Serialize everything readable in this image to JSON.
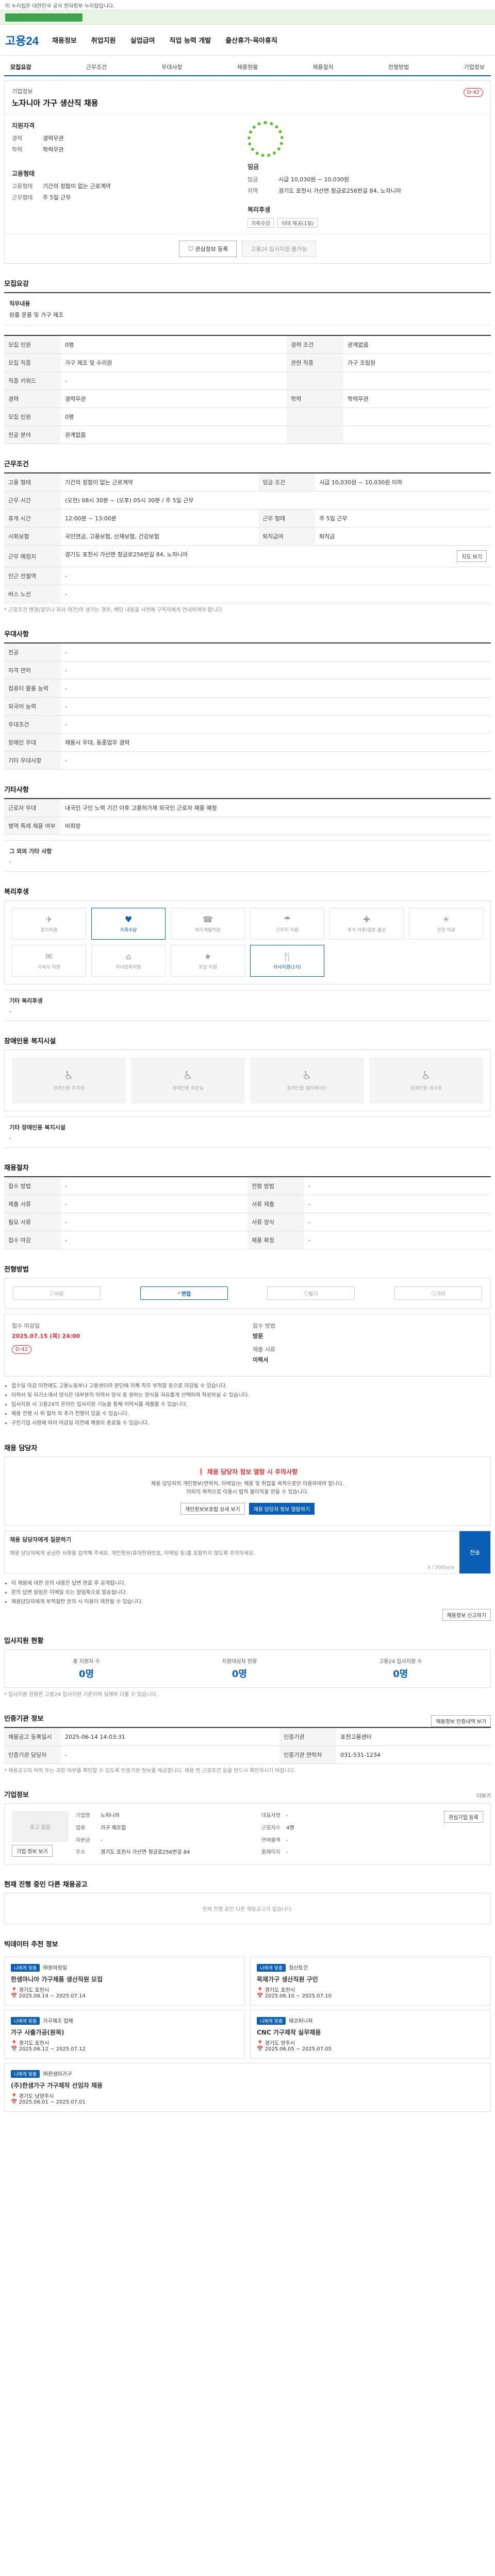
{
  "topbar": {
    "text": "이 누리집은 대한민국 공식 전자정부 누리집입니다."
  },
  "header": {
    "logo": "고용24",
    "nav": [
      "채용정보",
      "취업지원",
      "실업급여",
      "직업 능력 개발",
      "출산휴가·육아휴직"
    ]
  },
  "subnav": [
    "모집요강",
    "근무조건",
    "우대사항",
    "채용현황",
    "채용절차",
    "전형방법",
    "기업정보"
  ],
  "job": {
    "company": "기업정보",
    "title": "노자니아 가구 생산직 채용",
    "dday": "D-42",
    "summary_left": [
      {
        "k": "경력",
        "v": "경력무관"
      },
      {
        "k": "학력",
        "v": "학력무관"
      }
    ],
    "summary_left_title": "지원자격",
    "summary_left2_title": "고용형태",
    "summary_left2": [
      {
        "k": "고용형태",
        "v": "기간의 정함이 없는 근로계약"
      },
      {
        "k": "근무형태",
        "v": "주 5일 근무"
      }
    ],
    "summary_right_title": "임금",
    "summary_right": [
      {
        "k": "임금",
        "v": "시급 10,030원 ~ 10,030원"
      },
      {
        "k": "지역",
        "v": "경기도 포천시 가산면 청금로256번길 84, 노자니아"
      }
    ],
    "summary_right2_title": "복리후생",
    "tags": [
      "가족수당",
      "식대 제공(1일)"
    ],
    "btn_scrap": "관심정보 등록",
    "btn_apply": "고용24 입사지원 불가능"
  },
  "recruit": {
    "title": "모집요강",
    "duty_title": "직무내용",
    "duty": "원룸 운용 및 가구 제조",
    "rows": [
      [
        {
          "k": "모집 인원",
          "v": "0명"
        },
        {
          "k": "경력 조건",
          "v": "관계없음"
        }
      ],
      [
        {
          "k": "모집 직종",
          "v": "가구 제조 및 수리원"
        },
        {
          "k": "관련 직종",
          "v": "가구 조립원"
        }
      ],
      [
        {
          "k": "직종 키워드",
          "v": "-"
        },
        {
          "k": "",
          "v": ""
        }
      ],
      [
        {
          "k": "경력",
          "v": "경력무관"
        },
        {
          "k": "학력",
          "v": "학력무관"
        }
      ],
      [
        {
          "k": "모집 인원",
          "v": "0명"
        },
        {
          "k": "",
          "v": ""
        }
      ],
      [
        {
          "k": "전공 분야",
          "v": "관계없음"
        },
        {
          "k": "",
          "v": ""
        }
      ]
    ]
  },
  "work": {
    "title": "근무조건",
    "rows": [
      {
        "k": "고용 형태",
        "v": "기간의 정함이 없는 근로계약",
        "k2": "임금 조건",
        "v2": "시급 10,030원 ~ 10,030원 이하"
      },
      {
        "k": "근무 시간",
        "v": "(오전) 08시 30분 ~ (오후) 05시 30분 / 주 5일 근무",
        "k2": "",
        "v2": ""
      },
      {
        "k": "휴게 시간",
        "v": "12:00분 ~ 13:00분",
        "k2": "근무 형태",
        "v2": "주 5일 근무"
      },
      {
        "k": "사회보험",
        "v": "국민연금, 고용보험, 산재보험, 건강보험",
        "k2": "퇴직급여",
        "v2": "퇴직금"
      },
      {
        "k": "근무 예정지",
        "v": "경기도 포천시 가산면 청금로256번길 84, 노자니아",
        "k2": "",
        "v2": ""
      },
      {
        "k": "인근 전철역",
        "v": "-",
        "k2": "",
        "v2": ""
      },
      {
        "k": "버스 노선",
        "v": "-",
        "k2": "",
        "v2": ""
      }
    ],
    "map_btn": "지도 보기",
    "note": "* 근로조건 변경(업무나 회사 여건)이 생기는 경우, 해당 내용을 사전에 구직자에게 안내하여야 합니다."
  },
  "prefer": {
    "title": "우대사항",
    "rows": [
      {
        "k": "전공",
        "v": "-"
      },
      {
        "k": "자격 면허",
        "v": "-"
      },
      {
        "k": "컴퓨터 활용 능력",
        "v": "-"
      },
      {
        "k": "외국어 능력",
        "v": "-"
      },
      {
        "k": "우대조건",
        "v": "-"
      },
      {
        "k": "장애인 우대",
        "v": "채용시 우대, 동종업무 경력"
      },
      {
        "k": "기타 우대사항",
        "v": "-"
      }
    ]
  },
  "other": {
    "title": "기타사항",
    "rows": [
      {
        "k": "근로자 우대",
        "v": "내국인 구인 노력 기간 이후 고용허가제 외국인 근로자 채용 예정"
      },
      {
        "k": "병역 특례 채용 여부",
        "v": "비희망"
      }
    ],
    "extra_title": "그 외의 기타 사항",
    "extra": "-"
  },
  "welfare": {
    "title": "복리후생",
    "items": [
      {
        "icon": "✈",
        "label": "휴가지원",
        "on": false
      },
      {
        "icon": "♥",
        "label": "가족수당",
        "on": true
      },
      {
        "icon": "☎",
        "label": "자기계발지원",
        "on": false
      },
      {
        "icon": "☂",
        "label": "근무지 지원",
        "on": false
      },
      {
        "icon": "✚",
        "label": "주거 지원/결혼·출산",
        "on": false
      },
      {
        "icon": "☀",
        "label": "건강·의료",
        "on": false
      },
      {
        "icon": "✉",
        "label": "기숙사 지원",
        "on": false
      },
      {
        "icon": "⌂",
        "label": "자녀양육지원",
        "on": false
      },
      {
        "icon": "★",
        "label": "포상 지원",
        "on": false
      },
      {
        "icon": "🍴",
        "label": "식사지원(1식)",
        "on": true
      }
    ],
    "extra_title": "기타 복리후생",
    "extra": "-"
  },
  "disability": {
    "title": "장애인용 복지시설",
    "items": [
      {
        "icon": "♿",
        "label": "장애인용 주차장"
      },
      {
        "icon": "♿",
        "label": "장애인용 화장실"
      },
      {
        "icon": "♿",
        "label": "장애인용 엘리베이터"
      },
      {
        "icon": "♿",
        "label": "장애인용 경사로"
      }
    ],
    "extra_title": "기타 장애인용 복지시설",
    "extra": "-"
  },
  "process": {
    "title": "채용절차",
    "rows": [
      {
        "k": "접수 방법",
        "v": "-",
        "k2": "전형 방법",
        "v2": "-"
      },
      {
        "k": "제출 서류",
        "v": "-",
        "k2": "서류 제출",
        "v2": "-"
      },
      {
        "k": "필요 서류",
        "v": "-",
        "k2": "서류 양식",
        "v2": "-"
      },
      {
        "k": "접수 마감",
        "v": "-",
        "k2": "채용 확정",
        "v2": "-"
      }
    ]
  },
  "method": {
    "title": "전형방법",
    "steps": [
      {
        "label": "서류",
        "on": false
      },
      {
        "label": "면접",
        "on": true
      },
      {
        "label": "필기",
        "on": false
      },
      {
        "label": "기타",
        "on": false
      }
    ],
    "apply_deadline_label": "접수 마감일",
    "apply_deadline": "2025.07.15 (목) 24:00",
    "dday": "D-42",
    "method_label": "접수 방법",
    "method_value": "방문",
    "docs_label": "제출 서류",
    "docs_value": "이력서",
    "notes": [
      "접수일 마감 이전에도 고용노동부나 고용센터의 판단에 의해 직무 부적합 등으로 마감될 수 있습니다.",
      "이력서 및 자기소개서 양식은 대부분의 이력서 양식 중 원하는 양식을 자유롭게 선택하여 작성하실 수 있습니다.",
      "입사지원 시 고용24의 온라인 입사지원 기능을 통해 이력서를 제출할 수 있습니다.",
      "채용 진행 시 위 절차 외 추가 전형이 있을 수 있습니다.",
      "구인기업 사정에 따라 마감일 이전에 채용이 종료될 수 있습니다."
    ]
  },
  "manager": {
    "title": "채용 담당자",
    "warn_prefix": "채용 담당자 정보 열람 시 주의사항",
    "desc1": "채용 담당자의 개인정보(연락처, 이메일)는 채용 및 취업을 목적으로만 이용하여야 합니다.",
    "desc2": "이외의 목적으로 이용시 법적 불이익을 받을 수 있습니다.",
    "btn_company": "개인정보보호법 상세 보기",
    "btn_view": "채용 담당자 정보 열람하기",
    "inq_title": "채용 담당자에게 질문하기",
    "inq_placeholder": "채용 담당자에게 궁금한 사항을 입력해 주세요. 개인정보(휴대전화번호, 이메일 등)를 포함하지 않도록 주의하세요.",
    "inq_btn": "전송",
    "inq_count": "0 / 500byte",
    "notes": [
      "이 채용에 대한 문의 내용은 답변 완료 후 공개됩니다.",
      "문의 답변 알림은 이메일 또는 알림톡으로 발송됩니다.",
      "채용담당자에게 부적절한 문의 시 이용이 제한될 수 있습니다."
    ],
    "report_btn": "채용정보 신고하기"
  },
  "status": {
    "title": "입사지원 현황",
    "items": [
      {
        "l": "총 지원자 수",
        "n": "0명"
      },
      {
        "l": "지원대상자 현황",
        "n": "0명"
      },
      {
        "l": "고용24 입사지원 수",
        "n": "0명"
      }
    ],
    "note": "* 입사지원 현황은 고용24 입사지원 기준이며 실제와 다를 수 있습니다."
  },
  "auth": {
    "title": "인증기관 정보",
    "rows": [
      {
        "k": "채용공고 등록일시",
        "v": "2025-06-14 14:03:31",
        "k2": "인증기관",
        "v2": "포천고용센터"
      },
      {
        "k": "인증기관 담당자",
        "v": "-",
        "k2": "인증기관 연락처",
        "v2": "031-531-1234"
      }
    ],
    "btn": "채용정보 인증내역 보기",
    "note": "* 채용공고의 허위 또는 과장 여부를 확인할 수 있도록 인증기관 정보를 제공합니다. 채용 전 근로조건 등을 반드시 확인하시기 바랍니다."
  },
  "company": {
    "title": "기업정보",
    "logo": "로고 없음",
    "rows": [
      {
        "k": "기업명",
        "v": "노자니아"
      },
      {
        "k": "대표자명",
        "v": "-"
      },
      {
        "k": "업종",
        "v": "가구 제조업"
      },
      {
        "k": "근로자수",
        "v": "4명"
      },
      {
        "k": "자본금",
        "v": "-"
      },
      {
        "k": "연매출액",
        "v": "-"
      },
      {
        "k": "주소",
        "v": "경기도 포천시 가산면 청금로256번길 84"
      },
      {
        "k": "홈페이지",
        "v": "-"
      }
    ],
    "btn1": "기업 정보 보기",
    "btn2": "관심기업 등록",
    "more": "더보기"
  },
  "similar": {
    "title": "현재 진행 중인 다른 채용공고",
    "empty": "현재 진행 중인 다른 채용공고가 없습니다."
  },
  "recommend": {
    "title": "빅데이터 추천 정보",
    "items": [
      {
        "chip": "나에게 맞춤",
        "company": "㈜원하정밀",
        "title": "한샘마니아 가구제품 생산직원 모집",
        "loc": "경기도 포천시",
        "date": "2025.06.14 ~ 2025.07.14"
      },
      {
        "chip": "나에게 맞춤",
        "company": "청산토건",
        "title": "목재가구 생산직원 구인",
        "loc": "경기도 포천시",
        "date": "2025.06.10 ~ 2025.07.10"
      },
      {
        "chip": "나에게 맞춤",
        "company": "가구제조 업체",
        "title": "가구 사출가공(원목)",
        "loc": "경기도 포천시",
        "date": "2025.06.12 ~ 2025.07.12"
      },
      {
        "chip": "나에게 맞춤",
        "company": "에코퍼니처",
        "title": "CNC 가구제작 실무채용",
        "loc": "경기도 양주시",
        "date": "2025.06.05 ~ 2025.07.05"
      },
      {
        "chip": "나에게 맞춤",
        "company": "㈜한샘이가구",
        "title": "(주)한샘가구 가구제작 선임자 채용",
        "loc": "경기도 남양주시",
        "date": "2025.06.01 ~ 2025.07.01"
      }
    ]
  }
}
